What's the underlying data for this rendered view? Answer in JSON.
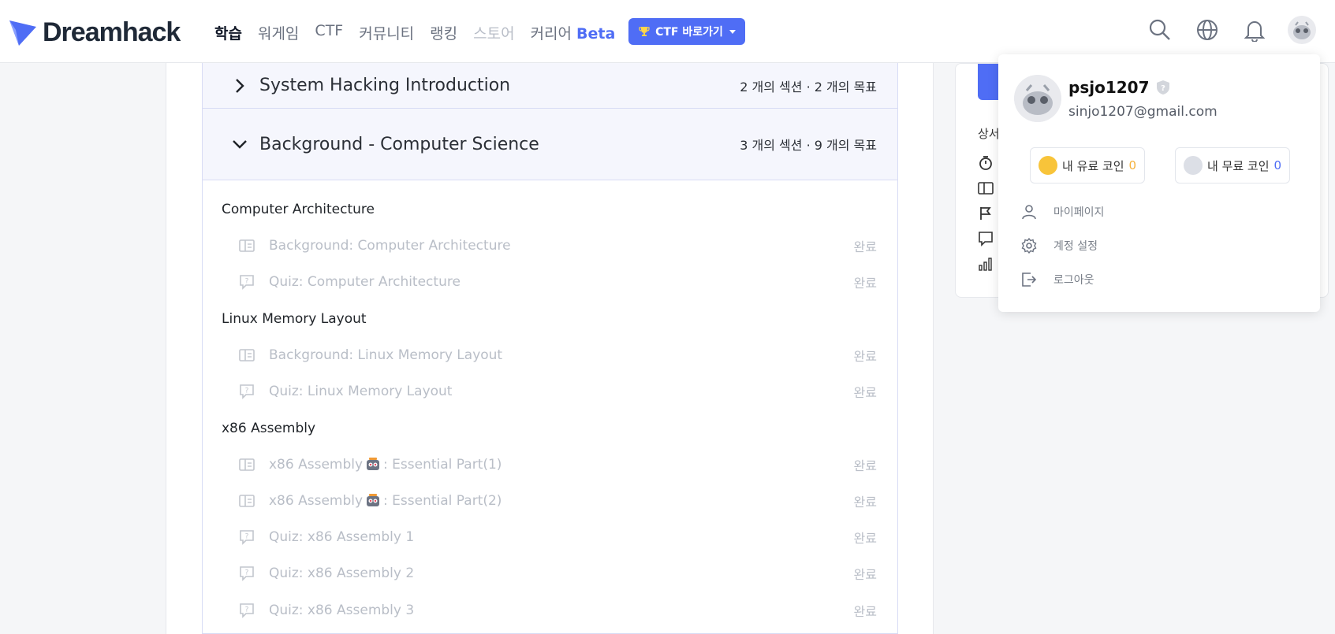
{
  "brand": {
    "name": "Dreamhack",
    "accent": "#4f6df5"
  },
  "nav": {
    "items": [
      "학습",
      "워게임",
      "CTF",
      "커뮤니티",
      "랭킹",
      "스토어",
      "커리어"
    ],
    "beta_label": "Beta",
    "ctf_button": "CTF 바로가기"
  },
  "sections": [
    {
      "title": "System Hacking Introduction",
      "meta": "2 개의 섹션 · 2 개의 목표",
      "expanded": false
    },
    {
      "title": "Background - Computer Science",
      "meta": "3 개의 섹션 · 9 개의 목표",
      "expanded": true
    }
  ],
  "groups": [
    {
      "title": "Computer Architecture",
      "lessons": [
        {
          "icon": "book-icon",
          "title": "Background: Computer Architecture",
          "status": "완료"
        },
        {
          "icon": "quiz-icon",
          "title": "Quiz: Computer Architecture",
          "status": "완료"
        }
      ]
    },
    {
      "title": "Linux Memory Layout",
      "lessons": [
        {
          "icon": "book-icon",
          "title": "Background: Linux Memory Layout",
          "status": "완료"
        },
        {
          "icon": "quiz-icon",
          "title": "Quiz: Linux Memory Layout",
          "status": "완료"
        }
      ]
    },
    {
      "title": "x86 Assembly",
      "lessons": [
        {
          "icon": "book-icon",
          "title_pre": "x86 Assembly",
          "title_post": ": Essential Part(1)",
          "status": "완료"
        },
        {
          "icon": "book-icon",
          "title_pre": "x86 Assembly",
          "title_post": ": Essential Part(2)",
          "status": "완료"
        },
        {
          "icon": "quiz-icon",
          "title": "Quiz: x86 Assembly 1",
          "status": "완료"
        },
        {
          "icon": "quiz-icon",
          "title": "Quiz: x86 Assembly 2",
          "status": "완료"
        },
        {
          "icon": "quiz-icon",
          "title": "Quiz: x86 Assembly 3",
          "status": "완료"
        }
      ]
    }
  ],
  "side_panel": {
    "label": "상서"
  },
  "user_menu": {
    "username": "psjo1207",
    "email": "sinjo1207@gmail.com",
    "paid_coin_label": "내 유료 코인",
    "paid_coin_value": "0",
    "free_coin_label": "내 무료 코인",
    "free_coin_value": "0",
    "items": [
      "마이페이지",
      "계정 설정",
      "로그아웃"
    ]
  }
}
